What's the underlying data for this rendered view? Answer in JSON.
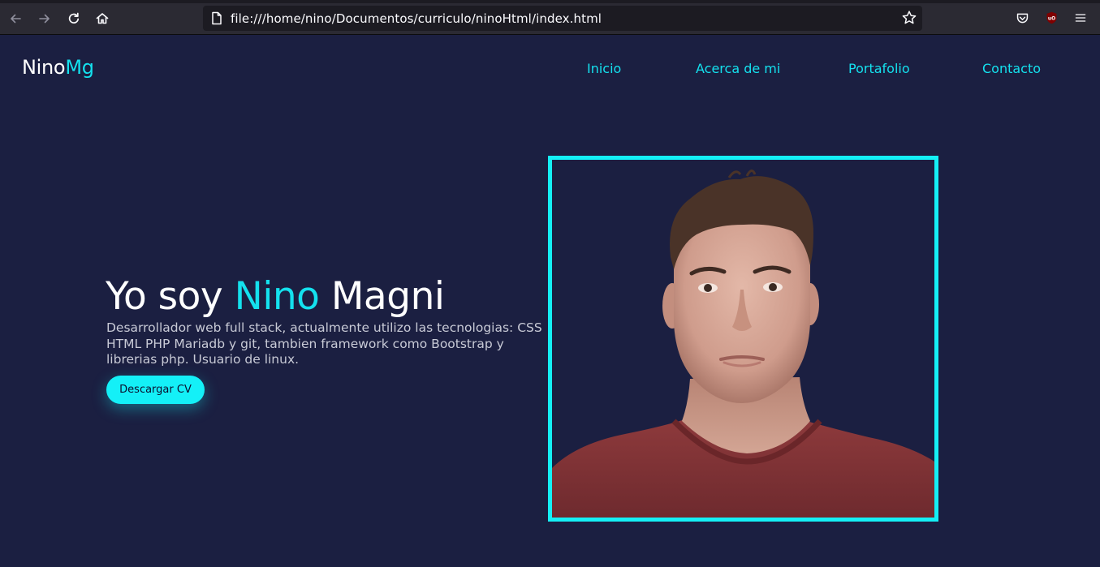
{
  "browser": {
    "url": "file:///home/nino/Documentos/curriculo/ninoHtml/index.html",
    "icons": {
      "back": "back-arrow-icon",
      "forward": "forward-arrow-icon",
      "reload": "reload-icon",
      "home": "home-icon",
      "page": "page-icon",
      "bookmark": "star-icon",
      "pocket": "pocket-icon",
      "extension": "ublock-origin-icon",
      "menu": "hamburger-menu-icon"
    }
  },
  "header": {
    "logo_main": "Nino",
    "logo_accent": "Mg",
    "nav": [
      {
        "label": "Inicio"
      },
      {
        "label": "Acerca de mi"
      },
      {
        "label": "Portafolio"
      },
      {
        "label": "Contacto"
      }
    ]
  },
  "hero": {
    "title_prefix": "Yo soy ",
    "title_accent": "Nino",
    "title_suffix": " Magni",
    "description": "Desarrollador web full stack, actualmente utilizo las tecnologias: CSS HTML PHP Mariadb y git, tambien framework como Bootstrap y librerias php. Usuario de linux.",
    "button_label": "Descargar CV"
  },
  "colors": {
    "background": "#1b1f41",
    "accent": "#14e1ee",
    "button": "#14f0f7",
    "chrome": "#2b2a33"
  }
}
